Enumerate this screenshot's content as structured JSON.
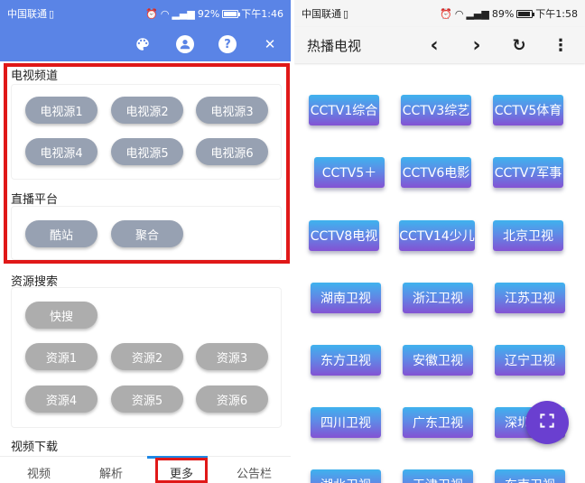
{
  "left": {
    "status": {
      "carrier": "中国联通",
      "battery": "92%",
      "time": "下午1:46"
    },
    "toolbar": {
      "icons": [
        "palette-icon",
        "account-icon",
        "help-icon",
        "close-icon"
      ],
      "help_glyph": "?",
      "close_glyph": "✕"
    },
    "tv_channels": {
      "title": "电视频道",
      "sources": [
        "电视源1",
        "电视源2",
        "电视源3",
        "电视源4",
        "电视源5",
        "电视源6"
      ]
    },
    "live": {
      "title": "直播平台",
      "items": [
        "酷站",
        "聚合"
      ]
    },
    "resources": {
      "title": "资源搜索",
      "quick": "快搜",
      "items": [
        "资源1",
        "资源2",
        "资源3",
        "资源4",
        "资源5",
        "资源6"
      ]
    },
    "download": {
      "title": "视频下载"
    },
    "nav": {
      "items": [
        "视频",
        "解析",
        "更多",
        "公告栏"
      ],
      "active": "更多"
    },
    "colors": {
      "primary": "#5a84e6",
      "highlight": "#e01818"
    }
  },
  "right": {
    "status": {
      "carrier": "中国联通",
      "battery": "89%",
      "time": "下午1:58"
    },
    "appbar": {
      "title": "热播电视",
      "back": "‹",
      "forward": "›",
      "refresh": "↻",
      "more": "⋮"
    },
    "channels": [
      "CCTV1综合",
      "CCTV3综艺",
      "CCTV5体育",
      "CCTV5＋",
      "CCTV6电影",
      "CCTV7军事",
      "CCTV8电视",
      "CCTV14少儿",
      "北京卫视",
      "湖南卫视",
      "浙江卫视",
      "江苏卫视",
      "东方卫视",
      "安徽卫视",
      "辽宁卫视",
      "四川卫视",
      "广东卫视",
      "深圳卫视",
      "湖北卫视",
      "天津卫视",
      "东南卫视"
    ],
    "fab": "fullscreen-icon"
  }
}
